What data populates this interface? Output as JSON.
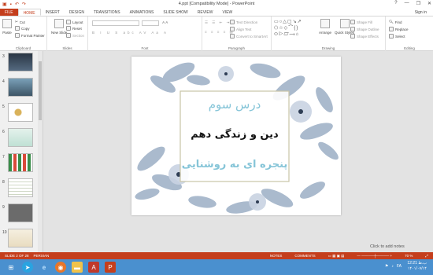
{
  "window": {
    "title": "4.ppt [Compatibility Mode] - PowerPoint",
    "controls": [
      "?",
      "—",
      "❐",
      "✕"
    ]
  },
  "tabs": {
    "file": "FILE",
    "items": [
      "HOME",
      "INSERT",
      "DESIGN",
      "TRANSITIONS",
      "ANIMATIONS",
      "SLIDE SHOW",
      "REVIEW",
      "VIEW"
    ],
    "signin": "Sign in"
  },
  "ribbon": {
    "clipboard": {
      "label": "Clipboard",
      "paste": "Paste",
      "cut": "Cut",
      "copy": "Copy",
      "format_painter": "Format Painter"
    },
    "slides": {
      "label": "Slides",
      "new_slide": "New Slide",
      "layout": "Layout",
      "reset": "Reset",
      "section": "Section"
    },
    "font": {
      "label": "Font"
    },
    "paragraph": {
      "label": "Paragraph",
      "text_direction": "Text Direction",
      "align_text": "Align Text",
      "convert_smartart": "Convert to SmartArt"
    },
    "drawing": {
      "label": "Drawing",
      "arrange": "Arrange",
      "quick_styles": "Quick Styles",
      "shape_fill": "Shape Fill",
      "shape_outline": "Shape Outline",
      "shape_effects": "Shape Effects"
    },
    "editing": {
      "label": "Editing",
      "find": "Find",
      "replace": "Replace",
      "select": "Select"
    }
  },
  "thumbnails": [
    {
      "num": "3"
    },
    {
      "num": "4"
    },
    {
      "num": "5"
    },
    {
      "num": "6"
    },
    {
      "num": "7"
    },
    {
      "num": "8"
    },
    {
      "num": "9"
    },
    {
      "num": "10"
    }
  ],
  "slide": {
    "line1": "درس سوم",
    "line2": "دین و زندگی دهم",
    "line3": "پنجره ای به روشنایی",
    "colors": {
      "line1": "#86c5d8",
      "line2": "#111111",
      "line3": "#86c5d8",
      "frame": "#c9c4a6"
    }
  },
  "notes_hint": "Click to add notes",
  "status": {
    "slide_of": "SLIDE 2 OF 28",
    "language": "PERSIAN",
    "notes": "NOTES",
    "comments": "COMMENTS",
    "zoom": "70 %"
  },
  "taskbar": {
    "apps": [
      "start-icon",
      "telegram-icon",
      "ie-icon",
      "firefox-icon",
      "explorer-icon",
      "acrobat-icon",
      "powerpoint-icon"
    ],
    "tray_lang": "FA",
    "clock_time": "12:21 ب.ظ",
    "clock_date": "۱۴۰۱/۰۷/۱۴"
  }
}
